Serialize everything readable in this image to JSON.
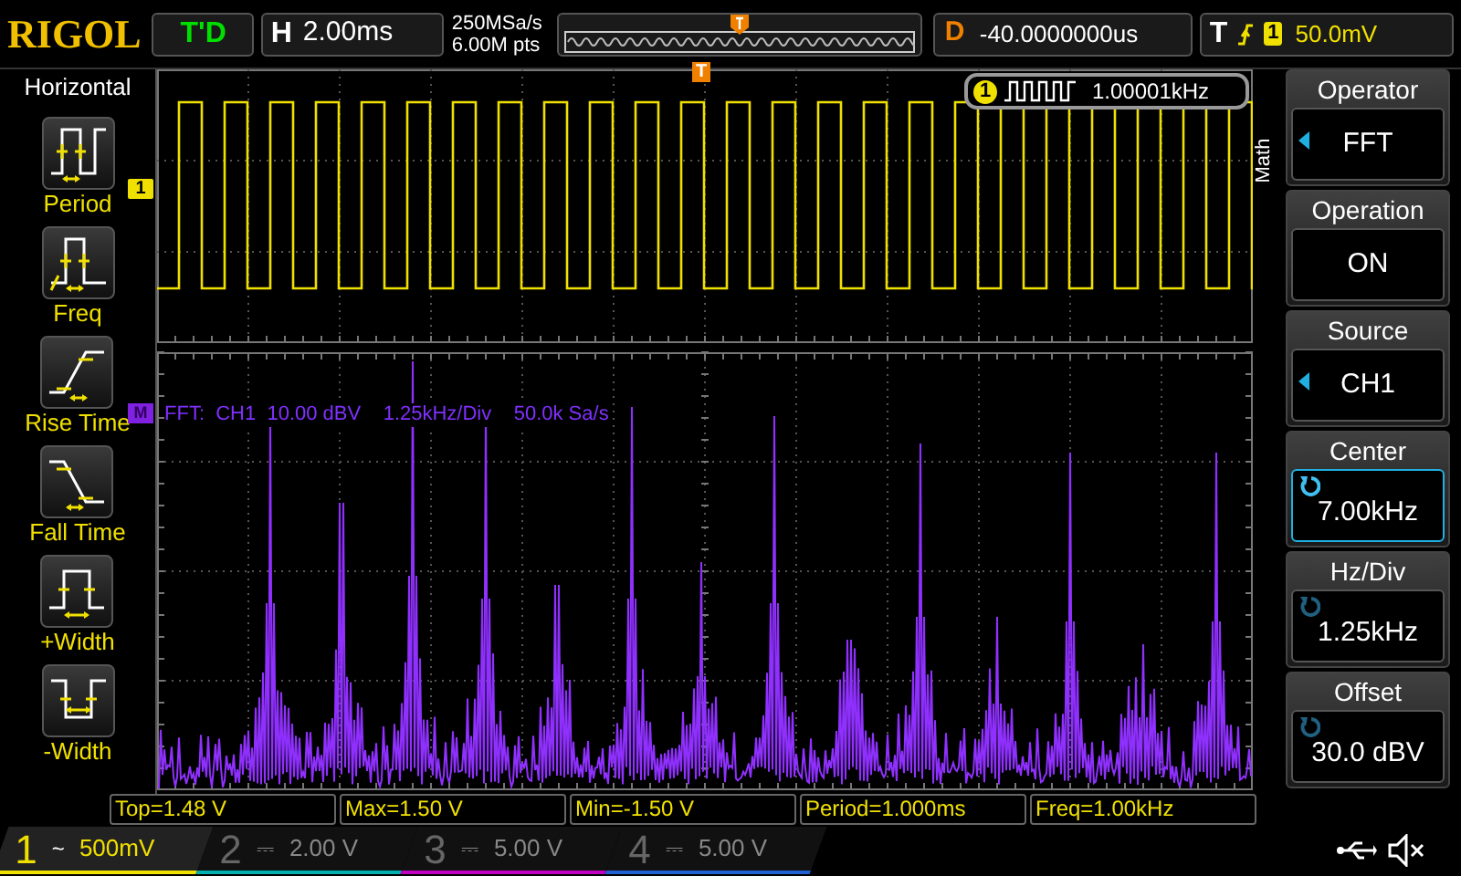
{
  "top_bar": {
    "logo": "RIGOL",
    "run_state": "T'D",
    "horizontal": {
      "label": "H",
      "value": "2.00ms"
    },
    "sample_rate": "250MSa/s",
    "memory_depth": "6.00M pts",
    "delay": {
      "label": "D",
      "value": "-40.0000000us"
    },
    "trigger": {
      "label": "T",
      "channel": "1",
      "level": "50.0mV"
    }
  },
  "left_menu": {
    "title": "Horizontal",
    "items": [
      {
        "label": "Period",
        "kind": "period"
      },
      {
        "label": "Freq",
        "kind": "freq"
      },
      {
        "label": "Rise Time",
        "kind": "rise"
      },
      {
        "label": "Fall Time",
        "kind": "fall"
      },
      {
        "label": "+Width",
        "kind": "pwidth"
      },
      {
        "label": "-Width",
        "kind": "nwidth"
      }
    ]
  },
  "waveform": {
    "channel_marker": "1",
    "trigger_marker": "T",
    "frequency_badge": {
      "channel": "1",
      "value": "1.00001kHz"
    }
  },
  "fft": {
    "marker": "M",
    "info": "FFT:  CH1  10.00 dBV    1.25kHz/Div    50.0k Sa/s"
  },
  "right_menu": {
    "tab": "Math",
    "items": [
      {
        "label": "Operator",
        "value": "FFT",
        "kind": "select",
        "selected": false
      },
      {
        "label": "Operation",
        "value": "ON",
        "kind": "toggle",
        "selected": false
      },
      {
        "label": "Source",
        "value": "CH1",
        "kind": "select",
        "selected": false
      },
      {
        "label": "Center",
        "value": "7.00kHz",
        "kind": "knob",
        "selected": true
      },
      {
        "label": "Hz/Div",
        "value": "1.25kHz",
        "kind": "knob",
        "selected": false
      },
      {
        "label": "Offset",
        "value": "30.0 dBV",
        "kind": "knob",
        "selected": false
      }
    ]
  },
  "measurements": [
    "Top=1.48 V",
    "Max=1.50 V",
    "Min=-1.50 V",
    "Period=1.000ms",
    "Freq=1.00kHz"
  ],
  "channels": [
    {
      "number": "1",
      "coupling": "~",
      "scale": "500mV",
      "on": true,
      "color": "#f0e000"
    },
    {
      "number": "2",
      "coupling": "⎓",
      "scale": "2.00 V",
      "on": false,
      "color": "#00b0b0"
    },
    {
      "number": "3",
      "coupling": "⎓",
      "scale": "5.00 V",
      "on": false,
      "color": "#c000c0"
    },
    {
      "number": "4",
      "coupling": "⎓",
      "scale": "5.00 V",
      "on": false,
      "color": "#2060d0"
    }
  ]
}
